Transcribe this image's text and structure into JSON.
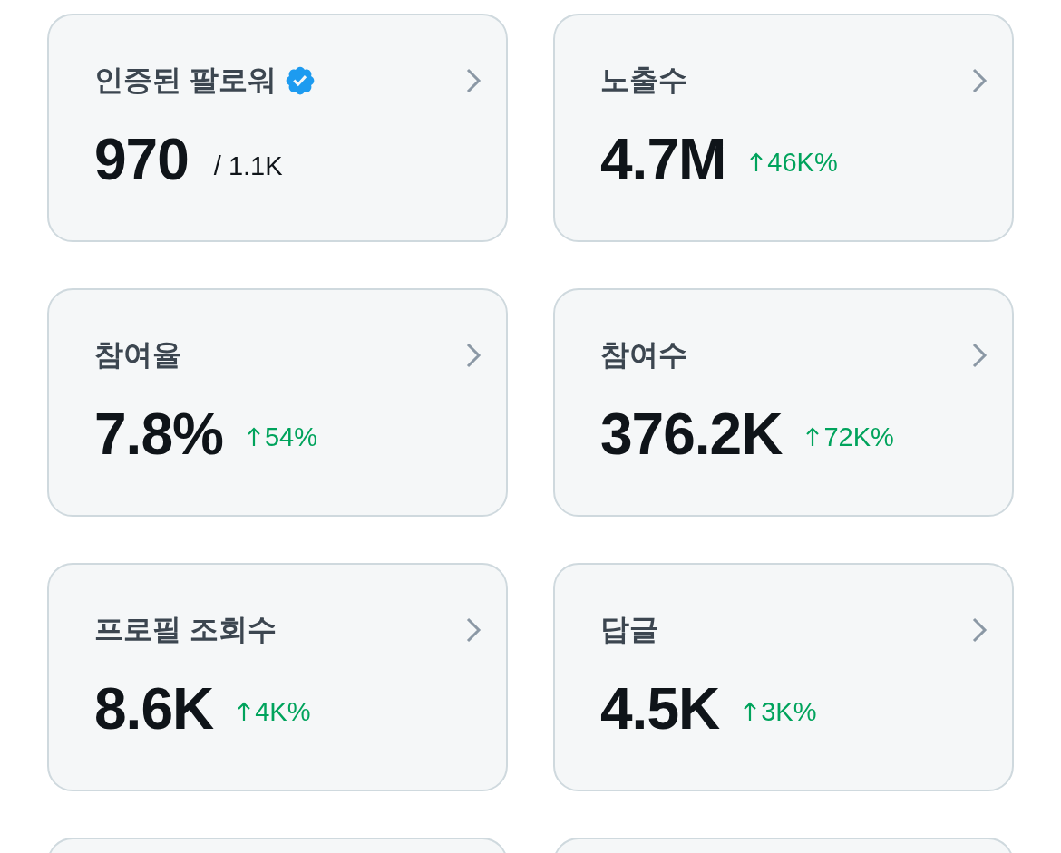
{
  "cards": [
    {
      "kind": "metric",
      "title": "인증된 팔로워",
      "verified": true,
      "value": "970",
      "total": "/ 1.1K"
    },
    {
      "kind": "metric",
      "title": "노출수",
      "verified": false,
      "value": "4.7M",
      "change": {
        "rising": true,
        "text": "46K%"
      }
    },
    {
      "kind": "metric",
      "title": "참여율",
      "verified": false,
      "value": "7.8%",
      "change": {
        "rising": true,
        "text": "54%"
      }
    },
    {
      "kind": "metric",
      "title": "참여수",
      "verified": false,
      "value": "376.2K",
      "change": {
        "rising": true,
        "text": "72K%"
      }
    },
    {
      "kind": "metric",
      "title": "프로필 조회수",
      "verified": false,
      "value": "8.6K",
      "change": {
        "rising": true,
        "text": "4K%"
      }
    },
    {
      "kind": "metric",
      "title": "답글",
      "verified": false,
      "value": "4.5K",
      "change": {
        "rising": true,
        "text": "3K%"
      }
    },
    {
      "kind": "cut"
    },
    {
      "kind": "cut"
    }
  ]
}
